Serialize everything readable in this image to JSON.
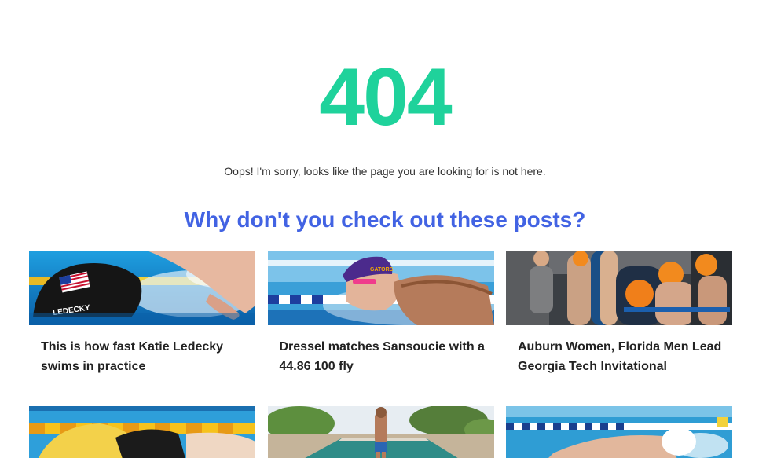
{
  "error": {
    "code": "404",
    "message": "Oops! I'm sorry, looks like the page you are looking for is not here."
  },
  "suggestions": {
    "heading": "Why don't you check out these posts?",
    "posts": [
      {
        "title": "This is how fast Katie Ledecky swims in practice",
        "image": "swimmer-usa-cap-freestyle"
      },
      {
        "title": "Dressel matches Sansoucie with a 44.86 100 fly",
        "image": "swimmer-butterfly-purple-cap"
      },
      {
        "title": "Auburn Women, Florida Men Lead Georgia Tech Invitational",
        "image": "swimmers-on-blocks-orange-caps"
      },
      {
        "title": "",
        "image": "swimmer-lane-lines-yellow"
      },
      {
        "title": "",
        "image": "swimmer-outdoor-pool-trees"
      },
      {
        "title": "",
        "image": "swimmer-freestyle-white-cap"
      }
    ]
  },
  "colors": {
    "accent_green": "#1fd29b",
    "accent_blue": "#4263e3"
  }
}
